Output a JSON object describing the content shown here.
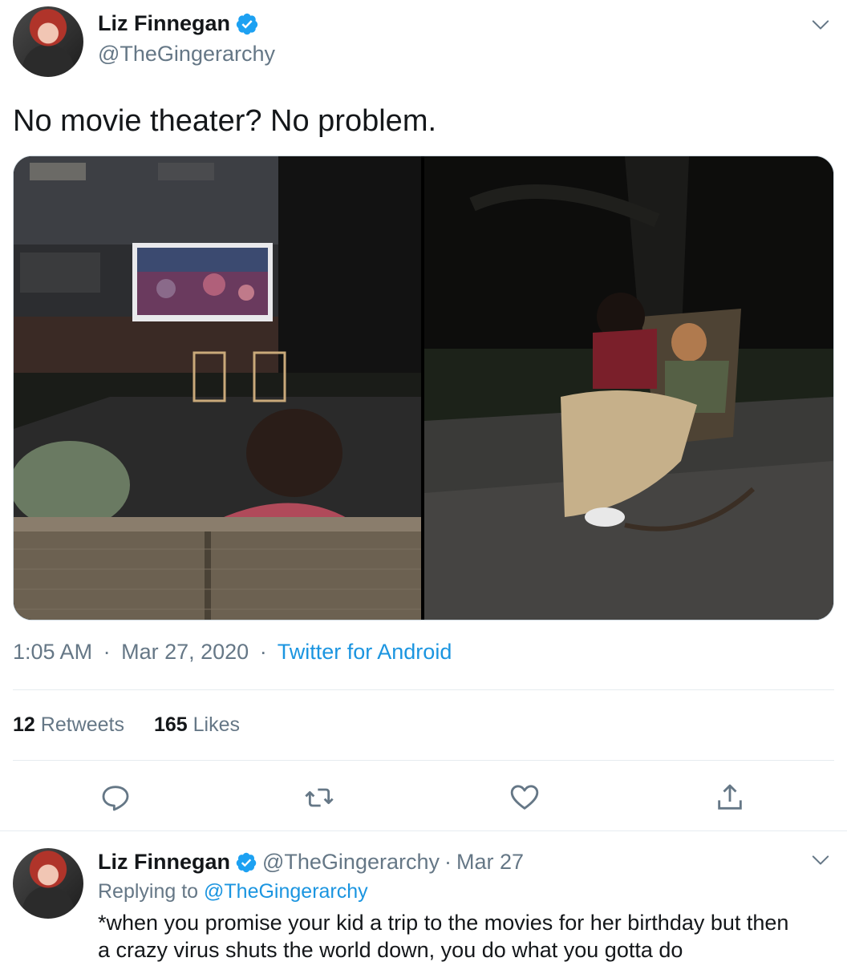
{
  "tweet": {
    "author_name": "Liz Finnegan",
    "author_handle": "@TheGingerarchy",
    "text": "No movie theater? No problem.",
    "time": "1:05 AM",
    "date": "Mar 27, 2020",
    "source": "Twitter for Android",
    "separator": "·",
    "retweets_count": "12",
    "retweets_label": "Retweets",
    "likes_count": "165",
    "likes_label": "Likes"
  },
  "reply": {
    "author_name": "Liz Finnegan",
    "author_handle": "@TheGingerarchy",
    "separator": "·",
    "date": "Mar 27",
    "replying_prefix": "Replying to",
    "replying_handle": "@TheGingerarchy",
    "text_line1": "*when you promise your kid a trip to the movies for her birthday but then",
    "text_line2": "a crazy virus shuts the world down, you do what you gotta do"
  },
  "icons": {
    "verified": "verified-badge-icon",
    "more": "chevron-down-icon",
    "reply": "reply-bubble-icon",
    "retweet": "retweet-icon",
    "like": "heart-icon",
    "share": "share-icon"
  },
  "colors": {
    "link": "#1b95e0",
    "verified": "#1da1f2",
    "secondary_text": "#657786",
    "primary_text": "#14171a",
    "divider": "#e6ecf0"
  }
}
